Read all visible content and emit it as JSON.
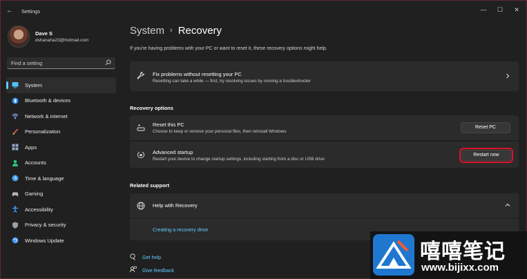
{
  "window": {
    "title": "Settings"
  },
  "profile": {
    "name": "Dave S",
    "email": "dshanaha23@hotmail.com"
  },
  "search": {
    "placeholder": "Find a setting"
  },
  "sidebar": {
    "items": [
      {
        "label": "System",
        "icon": "system-icon",
        "color": "#4cc2ff",
        "active": true
      },
      {
        "label": "Bluetooth & devices",
        "icon": "bluetooth-icon",
        "color": "#2f8cf2"
      },
      {
        "label": "Network & internet",
        "icon": "wifi-icon",
        "color": "#8ab4f8"
      },
      {
        "label": "Personalization",
        "icon": "brush-icon",
        "color": "#e9614a"
      },
      {
        "label": "Apps",
        "icon": "apps-icon",
        "color": "#8fa6c9"
      },
      {
        "label": "Accounts",
        "icon": "accounts-icon",
        "color": "#2ec27e"
      },
      {
        "label": "Time & language",
        "icon": "time-language-icon",
        "color": "#4aa3f0"
      },
      {
        "label": "Gaming",
        "icon": "gaming-icon",
        "color": "#b8b8b8"
      },
      {
        "label": "Accessibility",
        "icon": "accessibility-icon",
        "color": "#3fa3ff"
      },
      {
        "label": "Privacy & security",
        "icon": "shield-icon",
        "color": "#9aa0a6"
      },
      {
        "label": "Windows Update",
        "icon": "windows-update-icon",
        "color": "#3b8ef0"
      }
    ]
  },
  "main": {
    "breadcrumb_parent": "System",
    "breadcrumb_separator": "›",
    "title": "Recovery",
    "intro": "If you're having problems with your PC or want to reset it, these recovery options might help.",
    "fix_card": {
      "title": "Fix problems without resetting your PC",
      "subtitle": "Resetting can take a while — first, try resolving issues by running a troubleshooter"
    },
    "recovery_options_label": "Recovery options",
    "reset_card": {
      "title": "Reset this PC",
      "subtitle": "Choose to keep or remove your personal files, then reinstall Windows",
      "button": "Reset PC"
    },
    "advanced_card": {
      "title": "Advanced startup",
      "subtitle": "Restart your device to change startup settings, including starting from a disc or USB drive",
      "button": "Restart now"
    },
    "related_support_label": "Related support",
    "help_card": {
      "title": "Help with Recovery",
      "link": "Creating a recovery drive"
    },
    "get_help": "Get help",
    "give_feedback": "Give feedback"
  },
  "watermark": {
    "title": "嘻嘻笔记",
    "url": "www.bijixx.com"
  },
  "colors": {
    "accent": "#60cdff",
    "highlight": "#e0112b",
    "background": "#202020",
    "card": "#2b2b2b"
  }
}
